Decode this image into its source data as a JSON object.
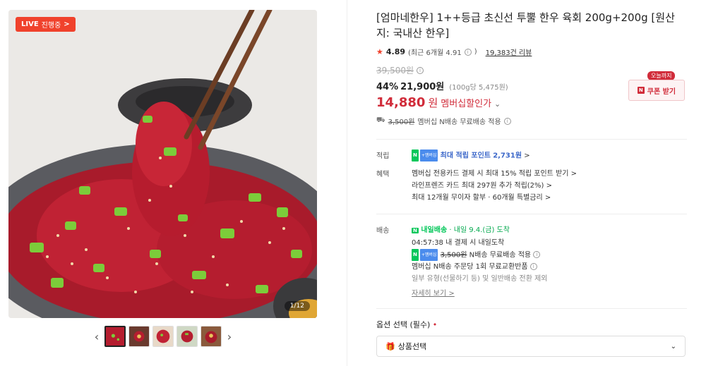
{
  "gallery": {
    "live_tag": "LIVE",
    "live_status": "진행중",
    "live_chevron": ">",
    "counter": "1/12",
    "prev_arrow": "‹",
    "next_arrow": "›",
    "thumbnails": 5
  },
  "product": {
    "title": "[엄마네한우] 1++등급 초신선 투뿔 한우 육회 200g+200g [원산지: 국내산 한우]",
    "rating": "4.89",
    "rating_detail": "(최근 6개월 4.91",
    "rating_detail_close": ")",
    "reviews": "19,383건 리뷰",
    "original_price": "39,500원",
    "sale_rate": "44%",
    "sale_price": "21,900원",
    "unit_price": "(100g당 5,475원)",
    "member_price": "14,880",
    "member_unit": "원",
    "member_label": "멤버십할인가",
    "member_chevron": "⌄",
    "coupon_tag": "오늘까지",
    "coupon_n": "N",
    "coupon_label": "쿠폰 받기",
    "shipping_strike": "3,500원",
    "shipping_text": "멤버십 N배송 무료배송 적용"
  },
  "benefits": {
    "points_label": "적립",
    "points_text": "최대 적립 포인트",
    "points_value": "2,731원",
    "points_chevron": ">",
    "perks_label": "혜택",
    "perks": [
      "멤버십 전용카드 결제 시 최대 15% 적립 포인트 받기 >",
      "라인프렌즈 카드 최대 297원 추가 적립(2%) >",
      "최대 12개월 무이자 할부 · 60개월 특별금리 >"
    ]
  },
  "delivery": {
    "label": "배송",
    "badge": "내일배송",
    "arrival": "· 내일 9.4.(금) 도착",
    "countdown": "04:57:38",
    "countdown_text": "내 결제 시 내일도착",
    "ship_strike": "3,500원",
    "ship_text": "N배송 무료배송 적용",
    "exchange": "멤버십 N배송 주문당 1회 무료교환반품",
    "exclude": "일부 유형(선물하기 등) 및 일반배송 전환 제외",
    "more": "자세히 보기 >"
  },
  "options": {
    "label": "옵션 선택 (필수)",
    "required_mark": "•",
    "select_value": "상품선택",
    "select_caret": "⌄"
  },
  "colors": {
    "accent_red": "#d12c3a",
    "live_red": "#f0422c",
    "naver_green": "#03c75a",
    "point_blue": "#3b67c9"
  }
}
